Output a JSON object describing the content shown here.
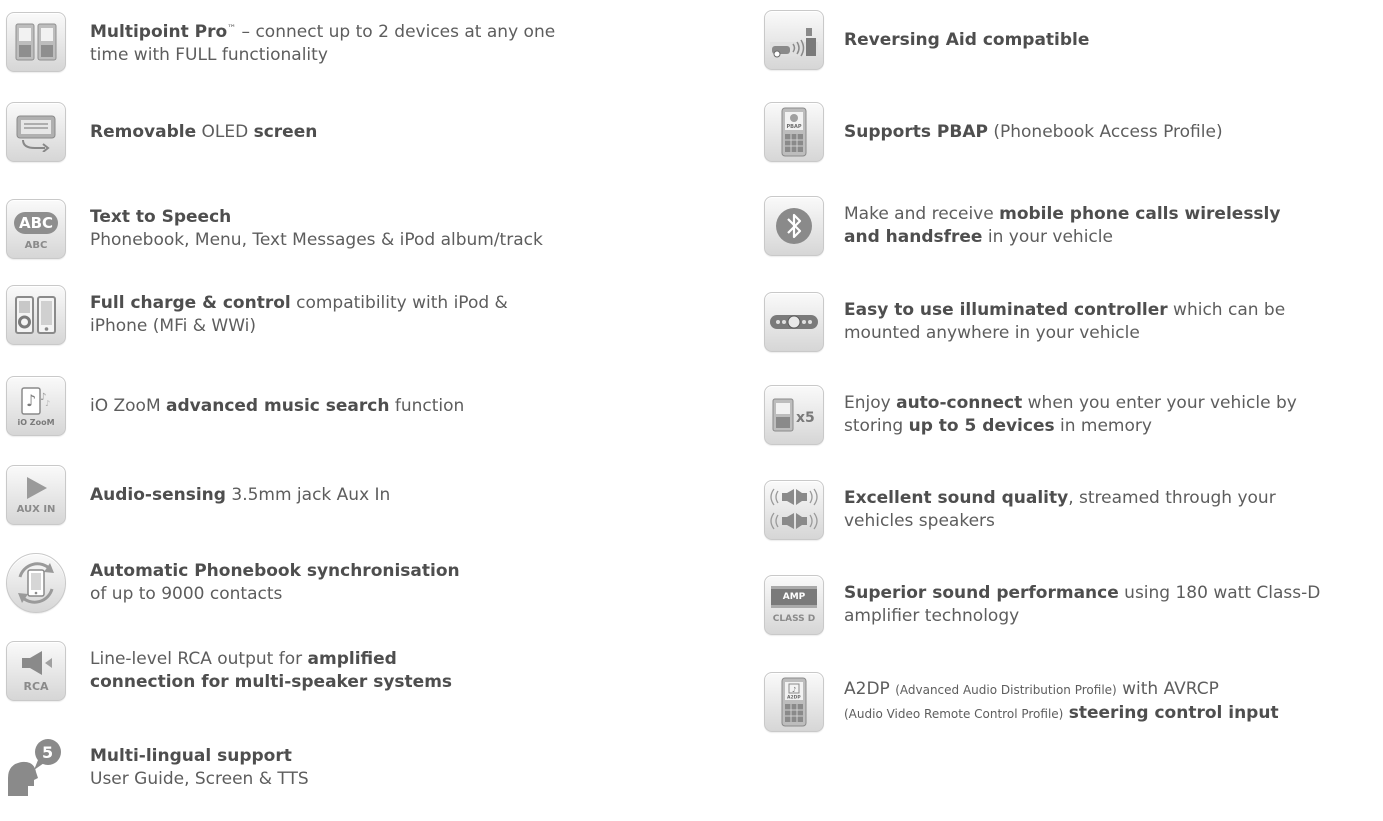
{
  "left": [
    {
      "icon": "dual-phone-icon",
      "parts": [
        {
          "t": "Multipoint Pro",
          "b": true
        },
        {
          "t": "™",
          "sup": true
        },
        {
          "t": " – connect up to 2 devices at any one"
        },
        {
          "br": true
        },
        {
          "t": "time with FULL functionality"
        }
      ]
    },
    {
      "icon": "removable-screen-icon",
      "parts": [
        {
          "t": "Removable",
          "b": true
        },
        {
          "t": " OLED "
        },
        {
          "t": "screen",
          "b": true
        }
      ]
    },
    {
      "icon": "text-to-speech-icon",
      "icon_text": [
        "ABC",
        "ABC"
      ],
      "parts": [
        {
          "t": "Text to Speech",
          "b": true
        },
        {
          "br": true
        },
        {
          "t": "Phonebook, Menu, Text Messages & iPod album/track"
        }
      ]
    },
    {
      "icon": "ipod-iphone-icon",
      "parts": [
        {
          "t": "Full charge & control",
          "b": true
        },
        {
          "t": " compatibility with iPod &"
        },
        {
          "br": true
        },
        {
          "t": "iPhone (MFi & WWi)"
        }
      ]
    },
    {
      "icon": "music-search-icon",
      "icon_text": [
        "iO ZooM"
      ],
      "parts": [
        {
          "t": "iO ZooM "
        },
        {
          "t": "advanced music search",
          "b": true
        },
        {
          "t": " function"
        }
      ]
    },
    {
      "icon": "aux-in-icon",
      "icon_text": [
        "AUX IN"
      ],
      "parts": [
        {
          "t": "Audio-sensing",
          "b": true
        },
        {
          "t": " 3.5mm jack Aux In"
        }
      ]
    },
    {
      "icon": "phonebook-sync-icon",
      "parts": [
        {
          "t": "Automatic Phonebook synchronisation",
          "b": true
        },
        {
          "br": true
        },
        {
          "t": "of up to 9000 contacts"
        }
      ]
    },
    {
      "icon": "rca-speaker-icon",
      "icon_text": [
        "RCA"
      ],
      "parts": [
        {
          "t": "Line-level RCA output for "
        },
        {
          "t": "amplified",
          "b": true
        },
        {
          "br": true
        },
        {
          "t": "connection for multi-speaker systems",
          "b": true
        }
      ]
    },
    {
      "icon": "multilingual-icon",
      "icon_text": [
        "5"
      ],
      "parts": [
        {
          "t": "Multi-lingual support",
          "b": true
        },
        {
          "br": true
        },
        {
          "t": "User Guide, Screen & TTS"
        }
      ]
    }
  ],
  "right": [
    {
      "icon": "reversing-aid-icon",
      "parts": [
        {
          "t": "Reversing Aid compatible",
          "b": true
        }
      ]
    },
    {
      "icon": "pbap-phone-icon",
      "icon_text": [
        "PBAP"
      ],
      "parts": [
        {
          "t": "Supports PBAP",
          "b": true
        },
        {
          "t": " (Phonebook Access Profile)"
        }
      ]
    },
    {
      "icon": "bluetooth-icon",
      "parts": [
        {
          "t": "Make and receive "
        },
        {
          "t": "mobile phone calls wirelessly",
          "b": true
        },
        {
          "br": true
        },
        {
          "t": "and handsfree",
          "b": true
        },
        {
          "t": " in your vehicle"
        }
      ]
    },
    {
      "icon": "controller-icon",
      "parts": [
        {
          "t": "Easy to use illuminated controller",
          "b": true
        },
        {
          "t": " which can be"
        },
        {
          "br": true
        },
        {
          "t": "mounted anywhere in your vehicle"
        }
      ]
    },
    {
      "icon": "five-devices-icon",
      "icon_text": [
        "x5"
      ],
      "parts": [
        {
          "t": "Enjoy "
        },
        {
          "t": "auto-connect",
          "b": true
        },
        {
          "t": " when you enter your vehicle by"
        },
        {
          "br": true
        },
        {
          "t": "storing "
        },
        {
          "t": "up to 5 devices",
          "b": true
        },
        {
          "t": " in memory"
        }
      ]
    },
    {
      "icon": "speakers-icon",
      "parts": [
        {
          "t": "Excellent sound quality",
          "b": true
        },
        {
          "t": ", streamed through your"
        },
        {
          "br": true
        },
        {
          "t": "vehicles speakers"
        }
      ]
    },
    {
      "icon": "amplifier-icon",
      "icon_text": [
        "AMP",
        "CLASS D"
      ],
      "parts": [
        {
          "t": "Superior sound performance",
          "b": true
        },
        {
          "t": " using 180 watt Class-D"
        },
        {
          "br": true
        },
        {
          "t": "amplifier technology"
        }
      ]
    },
    {
      "icon": "a2dp-phone-icon",
      "icon_text": [
        "A2DP"
      ],
      "parts": [
        {
          "t": "A2DP "
        },
        {
          "t": "(Advanced Audio Distribution Profile)",
          "small": true
        },
        {
          "t": " with AVRCP"
        },
        {
          "br": true
        },
        {
          "t": "(Audio Video Remote Control Profile)",
          "small": true
        },
        {
          "t": " "
        },
        {
          "t": "steering control input",
          "b": true
        }
      ]
    }
  ]
}
